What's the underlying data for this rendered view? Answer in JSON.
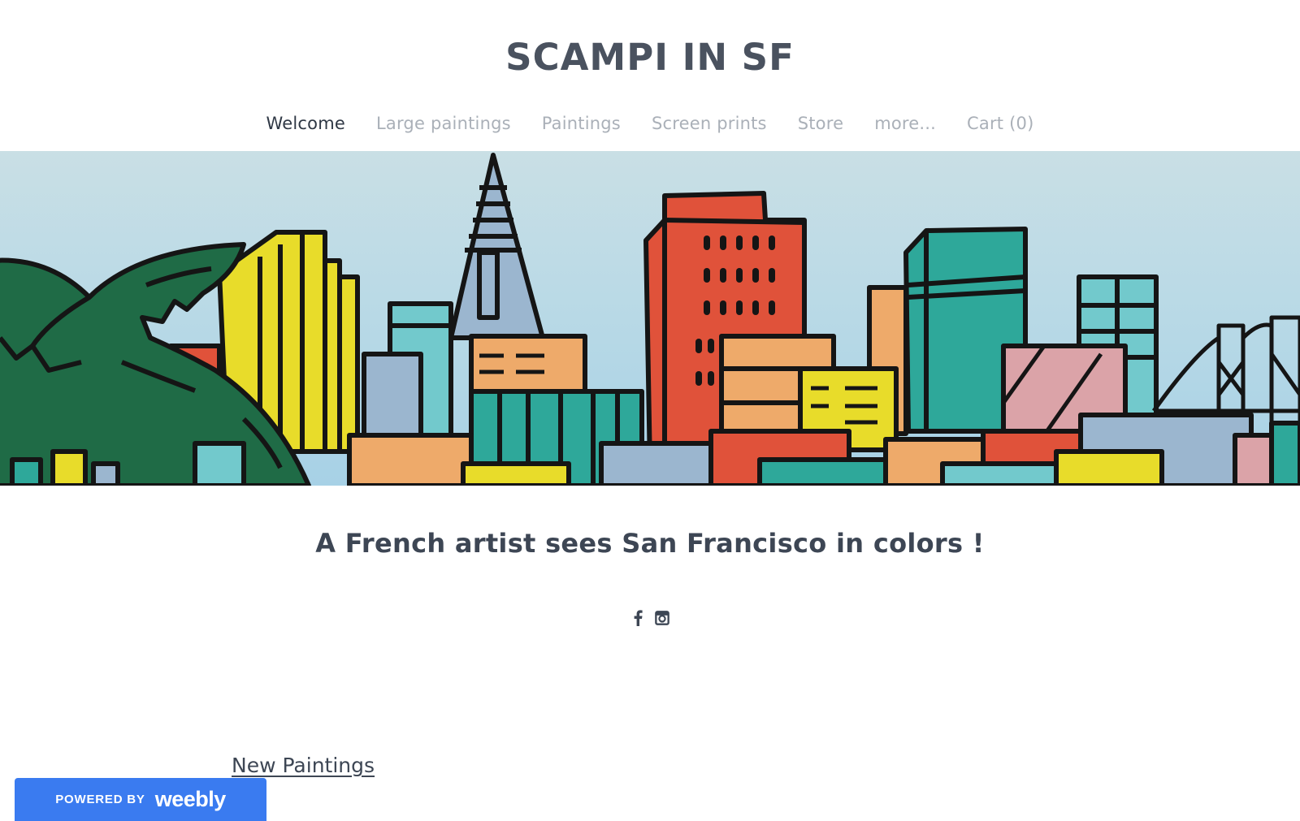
{
  "header": {
    "site_title": "SCAMPI IN SF"
  },
  "nav": {
    "items": [
      {
        "label": "Welcome",
        "active": true
      },
      {
        "label": "Large paintings",
        "active": false
      },
      {
        "label": "Paintings",
        "active": false
      },
      {
        "label": "Screen prints",
        "active": false
      },
      {
        "label": "Store",
        "active": false
      },
      {
        "label": "more...",
        "active": false
      },
      {
        "label": "Cart (0)",
        "active": false
      }
    ]
  },
  "banner": {
    "description": "Colorful painted San Francisco skyline with palm tree, Transamerica pyramid and Bay Bridge",
    "palette": {
      "sky": "#b9d9e6",
      "outline": "#151515",
      "green": "#1f6b46",
      "yellow": "#e8dc2a",
      "red": "#e0523a",
      "teal": "#2ea89a",
      "light_teal": "#72c9cc",
      "orange": "#eeaa6a",
      "pink": "#dba3a8",
      "blue_grey": "#9bb6cf"
    }
  },
  "main": {
    "tagline": "A French artist sees San Francisco in colors !",
    "social": [
      {
        "name": "facebook",
        "glyph": "f"
      },
      {
        "name": "instagram",
        "glyph": "instagram"
      }
    ],
    "section_link": "New Paintings"
  },
  "footer": {
    "powered_by": "POWERED BY",
    "brand": "weebly",
    "badge_color": "#3a7bf0"
  }
}
